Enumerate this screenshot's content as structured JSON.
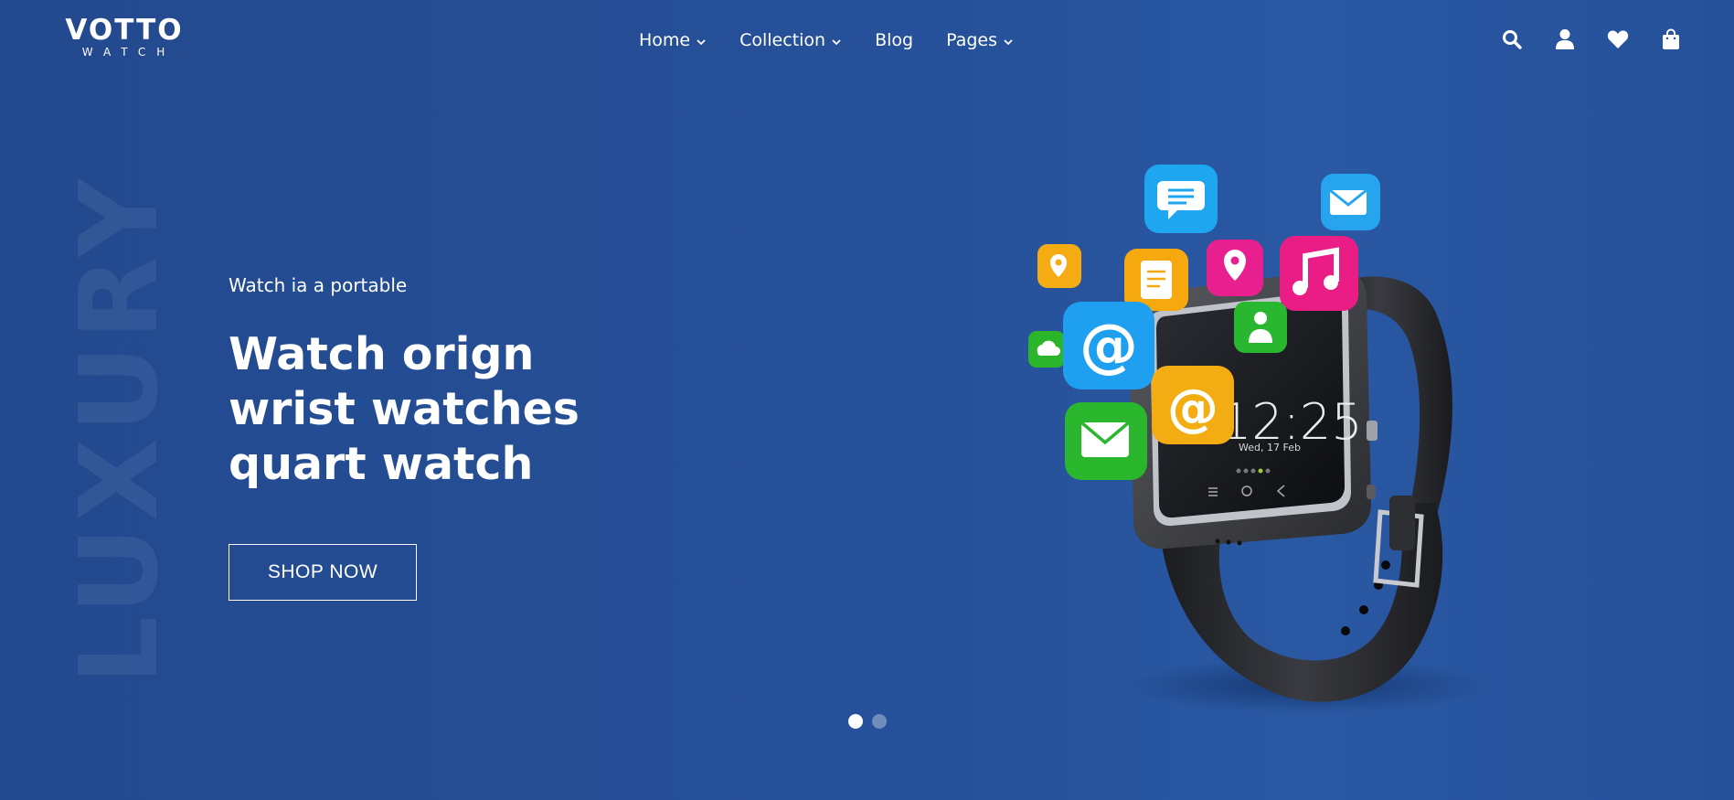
{
  "brand": {
    "name": "VOTTO",
    "sub": "WATCH"
  },
  "nav": {
    "items": [
      {
        "label": "Home",
        "dropdown": true
      },
      {
        "label": "Collection",
        "dropdown": true
      },
      {
        "label": "Blog",
        "dropdown": false
      },
      {
        "label": "Pages",
        "dropdown": true
      }
    ]
  },
  "header_icons": [
    "search-icon",
    "user-icon",
    "heart-icon",
    "bag-icon"
  ],
  "hero": {
    "watermark": "LUXURY",
    "tagline": "Watch ia a portable",
    "headline": [
      "Watch orign",
      "wrist watches",
      "quart watch"
    ],
    "cta": "SHOP NOW",
    "slides": {
      "count": 2,
      "active": 1
    },
    "watch_screen": {
      "time": "12:25",
      "date": "Wed, 17 Feb"
    }
  },
  "colors": {
    "background": "#254d93",
    "text": "#ffffff"
  }
}
